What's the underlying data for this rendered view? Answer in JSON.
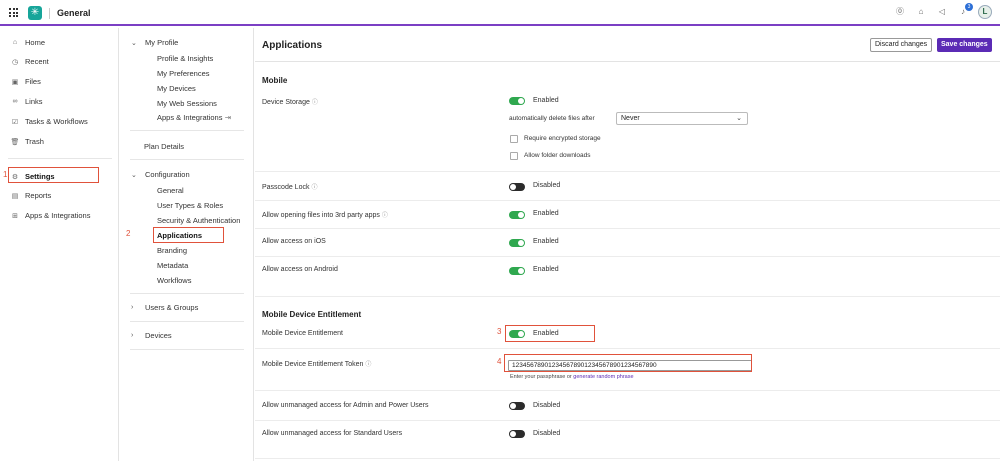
{
  "topbar": {
    "app_title": "General",
    "notification_count": "3",
    "avatar_initial": "L"
  },
  "nav_primary": [
    {
      "label": "Home",
      "icon": "home-icon"
    },
    {
      "label": "Recent",
      "icon": "clock-icon"
    },
    {
      "label": "Files",
      "icon": "files-icon"
    },
    {
      "label": "Links",
      "icon": "link-icon"
    },
    {
      "label": "Tasks & Workflows",
      "icon": "tasks-icon"
    },
    {
      "label": "Trash",
      "icon": "trash-icon"
    },
    {
      "label": "Settings",
      "icon": "settings-icon",
      "active": true
    },
    {
      "label": "Reports",
      "icon": "reports-icon"
    },
    {
      "label": "Apps & Integrations",
      "icon": "apps-icon"
    }
  ],
  "nav_secondary": {
    "my_profile": {
      "title": "My Profile",
      "items": [
        "Profile & Insights",
        "My Preferences",
        "My Devices",
        "My Web Sessions",
        "Apps & Integrations"
      ]
    },
    "plan_details": "Plan Details",
    "configuration": {
      "title": "Configuration",
      "items": [
        "General",
        "User Types & Roles",
        "Security & Authentication",
        "Applications",
        "Branding",
        "Metadata",
        "Workflows"
      ],
      "active": "Applications"
    },
    "users_groups": "Users & Groups",
    "devices": "Devices"
  },
  "main": {
    "title": "Applications",
    "discard_label": "Discard changes",
    "save_label": "Save changes",
    "mobile": {
      "section_title": "Mobile",
      "device_storage": {
        "label": "Device Storage",
        "state": "Enabled",
        "auto_delete_label": "automatically delete files after",
        "auto_delete_value": "Never",
        "require_encrypted": "Require encrypted storage",
        "allow_folder_downloads": "Allow folder downloads"
      },
      "passcode_lock": {
        "label": "Passcode Lock",
        "state": "Disabled"
      },
      "open_3rd_party": {
        "label": "Allow opening files into 3rd party apps",
        "state": "Enabled"
      },
      "access_ios": {
        "label": "Allow access on iOS",
        "state": "Enabled"
      },
      "access_android": {
        "label": "Allow access on Android",
        "state": "Enabled"
      }
    },
    "entitlement": {
      "section_title": "Mobile Device Entitlement",
      "entitlement_row": {
        "label": "Mobile Device Entitlement",
        "state": "Enabled"
      },
      "token_row": {
        "label": "Mobile Device Entitlement Token",
        "value": "1234567890123456789012345678901234567890",
        "hint_prefix": "Enter your passphrase or",
        "hint_link": "generate random phrase"
      },
      "unmanaged_admin": {
        "label": "Allow unmanaged access for Admin and Power Users",
        "state": "Disabled"
      },
      "unmanaged_standard": {
        "label": "Allow unmanaged access for Standard Users",
        "state": "Disabled"
      }
    }
  },
  "callouts": [
    "1",
    "2",
    "3",
    "4"
  ],
  "colors": {
    "accent": "#5b2bb5",
    "toggle_on": "#2fa84f",
    "callout": "#e0523b",
    "logo": "#17a59a"
  }
}
